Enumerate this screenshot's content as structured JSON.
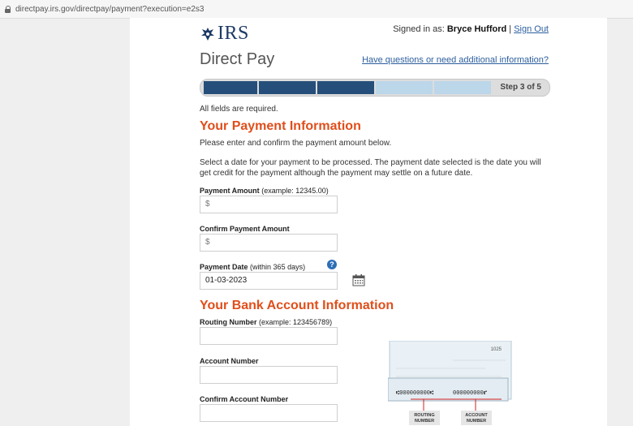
{
  "browser": {
    "url": "directpay.irs.gov/directpay/payment?execution=e2s3"
  },
  "header": {
    "logo_text": "IRS",
    "signed_prefix": "Signed in as:",
    "user_name": "Bryce Hufford",
    "separator": "|",
    "sign_out": "Sign Out",
    "title": "Direct Pay",
    "help_link": "Have questions or need additional information?"
  },
  "progress": {
    "step_label": "Step 3 of 5",
    "current": 3,
    "total": 5
  },
  "form": {
    "required_note": "All fields are required.",
    "section1_title": "Your Payment Information",
    "instruction1": "Please enter and confirm the payment amount below.",
    "instruction2": "Select a date for your payment to be processed. The payment date selected is the date you will get credit for the payment although the payment may settle on a future date.",
    "amount_label": "Payment Amount",
    "amount_hint": "(example: 12345.00)",
    "amount_placeholder": "$",
    "confirm_amount_label": "Confirm Payment Amount",
    "confirm_amount_placeholder": "$",
    "date_label": "Payment Date",
    "date_hint": "(within 365 days)",
    "date_value": "01-03-2023",
    "section2_title": "Your Bank Account Information",
    "routing_label": "Routing Number",
    "routing_hint": "(example: 123456789)",
    "account_label": "Account Number",
    "confirm_account_label": "Confirm Account Number",
    "routing_caption_1": "ROUTING",
    "routing_caption_2": "NUMBER",
    "account_caption_1": "ACCOUNT",
    "account_caption_2": "NUMBER",
    "check_number": "1025",
    "check_routing_digits": "⑆000000000⑆",
    "check_account_digits": "000000000⑈"
  },
  "colors": {
    "accent": "#e04e1b",
    "progress_filled": "#254f7a",
    "progress_empty": "#bcd6ea",
    "link": "#2c5f9e"
  }
}
